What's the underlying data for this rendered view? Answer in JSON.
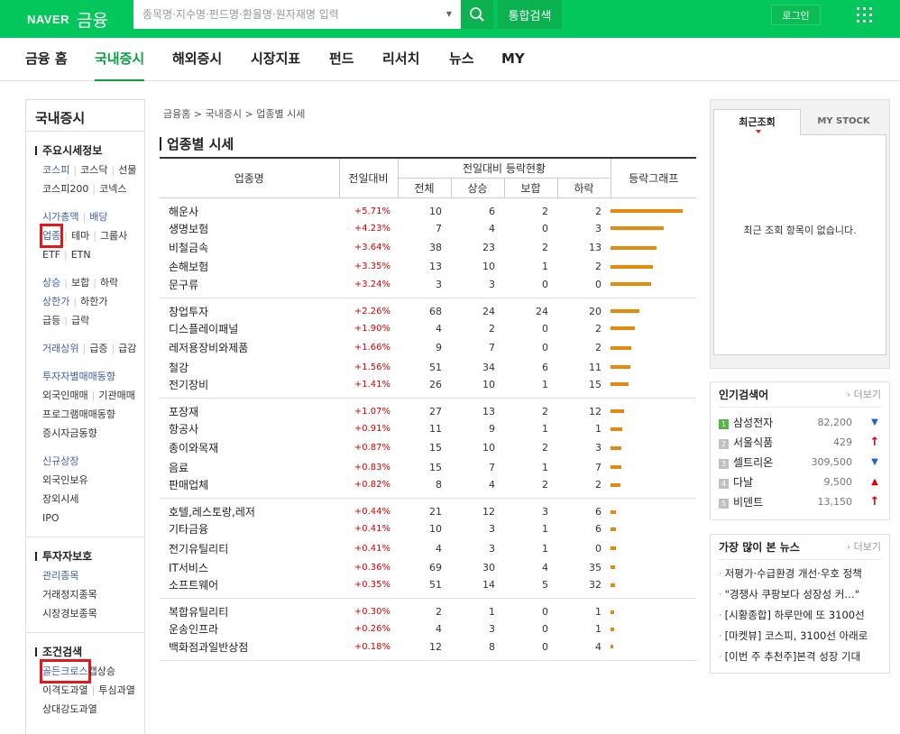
{
  "header": {
    "logo_brand": "NAVER",
    "logo_section": "금융",
    "search_placeholder": "종목명·지수명·펀드명·환율명·원자재명 입력",
    "unified_search_label": "통합검색",
    "login_label": "로그인"
  },
  "gnb": [
    {
      "label": "금융 홈",
      "active": false
    },
    {
      "label": "국내증시",
      "active": true
    },
    {
      "label": "해외증시",
      "active": false
    },
    {
      "label": "시장지표",
      "active": false
    },
    {
      "label": "펀드",
      "active": false
    },
    {
      "label": "리서치",
      "active": false
    },
    {
      "label": "뉴스",
      "active": false
    },
    {
      "label": "MY",
      "active": false
    }
  ],
  "lnb": {
    "title": "국내증시",
    "sections": [
      {
        "title": "주요시세정보",
        "rows": [
          [
            {
              "t": "코스피",
              "c": "blue"
            },
            {
              "t": "코스닥",
              "c": ""
            },
            {
              "t": "선물",
              "c": ""
            }
          ],
          [
            {
              "t": "코스피200",
              "c": ""
            },
            {
              "t": "코넥스",
              "c": ""
            }
          ],
          [],
          [
            {
              "t": "시가총액",
              "c": "blue"
            },
            {
              "t": "배당",
              "c": "blue"
            }
          ],
          [
            {
              "t": "업종",
              "c": "blue",
              "hl": true
            },
            {
              "t": "테마",
              "c": ""
            },
            {
              "t": "그룹사",
              "c": ""
            }
          ],
          [
            {
              "t": "ETF",
              "c": ""
            },
            {
              "t": "ETN",
              "c": ""
            }
          ],
          [],
          [
            {
              "t": "상승",
              "c": "blue"
            },
            {
              "t": "보합",
              "c": ""
            },
            {
              "t": "하락",
              "c": ""
            }
          ],
          [
            {
              "t": "상한가",
              "c": "blue"
            },
            {
              "t": "하한가",
              "c": ""
            }
          ],
          [
            {
              "t": "급등",
              "c": ""
            },
            {
              "t": "급락",
              "c": ""
            }
          ],
          [],
          [
            {
              "t": "거래상위",
              "c": "blue"
            },
            {
              "t": "급증",
              "c": ""
            },
            {
              "t": "급감",
              "c": ""
            }
          ],
          [],
          [
            {
              "t": "투자자별매매동향",
              "c": "blue"
            }
          ],
          [
            {
              "t": "외국인매매",
              "c": ""
            },
            {
              "t": "기관매매",
              "c": ""
            }
          ],
          [
            {
              "t": "프로그램매매동향",
              "c": ""
            }
          ],
          [
            {
              "t": "증시자금동향",
              "c": ""
            }
          ],
          [],
          [
            {
              "t": "신규상장",
              "c": "blue"
            }
          ],
          [
            {
              "t": "외국인보유",
              "c": ""
            }
          ],
          [
            {
              "t": "장외시세",
              "c": ""
            }
          ],
          [
            {
              "t": "IPO",
              "c": ""
            }
          ]
        ]
      },
      {
        "title": "투자자보호",
        "rows": [
          [
            {
              "t": "관리종목",
              "c": "blue"
            }
          ],
          [
            {
              "t": "거래정지종목",
              "c": ""
            }
          ],
          [
            {
              "t": "시장경보종목",
              "c": ""
            }
          ]
        ]
      },
      {
        "title": "조건검색",
        "rows": [
          [
            {
              "t": "골든크로스",
              "c": "blue",
              "hl": true
            },
            {
              "t": "갭상승",
              "c": "",
              "nosep": true
            }
          ],
          [
            {
              "t": "이격도과열",
              "c": ""
            },
            {
              "t": "투심과열",
              "c": ""
            }
          ],
          [
            {
              "t": "상대강도과열",
              "c": ""
            }
          ]
        ]
      }
    ]
  },
  "main": {
    "breadcrumb": "금융홈 > 국내증시 > 업종별 시세",
    "title": "업종별 시세",
    "headers": {
      "name": "업종명",
      "change": "전일대비",
      "group": "전일대비 등락현황",
      "total": "전체",
      "up": "상승",
      "flat": "보합",
      "down": "하락",
      "graph": "등락그래프"
    },
    "groups": [
      [
        {
          "name": "해운사",
          "change": "+5.71%",
          "total": 10,
          "up": 6,
          "flat": 2,
          "down": 2,
          "pct": 5.71
        },
        {
          "name": "생명보험",
          "change": "+4.23%",
          "total": 7,
          "up": 4,
          "flat": 0,
          "down": 3,
          "pct": 4.23
        },
        {
          "name": "비철금속",
          "change": "+3.64%",
          "total": 38,
          "up": 23,
          "flat": 2,
          "down": 13,
          "pct": 3.64
        },
        {
          "name": "손해보험",
          "change": "+3.35%",
          "total": 13,
          "up": 10,
          "flat": 1,
          "down": 2,
          "pct": 3.35
        },
        {
          "name": "문구류",
          "change": "+3.24%",
          "total": 3,
          "up": 3,
          "flat": 0,
          "down": 0,
          "pct": 3.24
        }
      ],
      [
        {
          "name": "창업투자",
          "change": "+2.26%",
          "total": 68,
          "up": 24,
          "flat": 24,
          "down": 20,
          "pct": 2.26
        },
        {
          "name": "디스플레이패널",
          "change": "+1.90%",
          "total": 4,
          "up": 2,
          "flat": 0,
          "down": 2,
          "pct": 1.9
        },
        {
          "name": "레저용장비와제품",
          "change": "+1.66%",
          "total": 9,
          "up": 7,
          "flat": 0,
          "down": 2,
          "pct": 1.66
        },
        {
          "name": "철강",
          "change": "+1.56%",
          "total": 51,
          "up": 34,
          "flat": 6,
          "down": 11,
          "pct": 1.56
        },
        {
          "name": "전기장비",
          "change": "+1.41%",
          "total": 26,
          "up": 10,
          "flat": 1,
          "down": 15,
          "pct": 1.41
        }
      ],
      [
        {
          "name": "포장재",
          "change": "+1.07%",
          "total": 27,
          "up": 13,
          "flat": 2,
          "down": 12,
          "pct": 1.07
        },
        {
          "name": "항공사",
          "change": "+0.91%",
          "total": 11,
          "up": 9,
          "flat": 1,
          "down": 1,
          "pct": 0.91
        },
        {
          "name": "종이와목재",
          "change": "+0.87%",
          "total": 15,
          "up": 10,
          "flat": 2,
          "down": 3,
          "pct": 0.87
        },
        {
          "name": "음료",
          "change": "+0.83%",
          "total": 15,
          "up": 7,
          "flat": 1,
          "down": 7,
          "pct": 0.83
        },
        {
          "name": "판매업체",
          "change": "+0.82%",
          "total": 8,
          "up": 4,
          "flat": 2,
          "down": 2,
          "pct": 0.82
        }
      ],
      [
        {
          "name": "호텔,레스토랑,레저",
          "change": "+0.44%",
          "total": 21,
          "up": 12,
          "flat": 3,
          "down": 6,
          "pct": 0.44
        },
        {
          "name": "기타금융",
          "change": "+0.41%",
          "total": 10,
          "up": 3,
          "flat": 1,
          "down": 6,
          "pct": 0.41
        },
        {
          "name": "전기유틸리티",
          "change": "+0.41%",
          "total": 4,
          "up": 3,
          "flat": 1,
          "down": 0,
          "pct": 0.41
        },
        {
          "name": "IT서비스",
          "change": "+0.36%",
          "total": 69,
          "up": 30,
          "flat": 4,
          "down": 35,
          "pct": 0.36
        },
        {
          "name": "소프트웨어",
          "change": "+0.35%",
          "total": 51,
          "up": 14,
          "flat": 5,
          "down": 32,
          "pct": 0.35
        }
      ],
      [
        {
          "name": "복합유틸리티",
          "change": "+0.30%",
          "total": 2,
          "up": 1,
          "flat": 0,
          "down": 1,
          "pct": 0.3
        },
        {
          "name": "운송인프라",
          "change": "+0.26%",
          "total": 4,
          "up": 3,
          "flat": 0,
          "down": 1,
          "pct": 0.26
        },
        {
          "name": "백화점과일반상점",
          "change": "+0.18%",
          "total": 12,
          "up": 8,
          "flat": 0,
          "down": 4,
          "pct": 0.18
        }
      ]
    ]
  },
  "right": {
    "tab_recent": "최근조회",
    "tab_mystock": "MY STOCK",
    "recent_empty": "최근 조회 항목이 없습니다.",
    "popular_title": "인기검색어",
    "more_label": "더보기",
    "popular": [
      {
        "rank": "1",
        "name": "삼성전자",
        "price": "82,200",
        "dir": "down"
      },
      {
        "rank": "2",
        "name": "서울식품",
        "price": "429",
        "dir": "upper"
      },
      {
        "rank": "3",
        "name": "셀트리온",
        "price": "309,500",
        "dir": "down"
      },
      {
        "rank": "4",
        "name": "다날",
        "price": "9,500",
        "dir": "up"
      },
      {
        "rank": "5",
        "name": "비덴트",
        "price": "13,150",
        "dir": "upper"
      }
    ],
    "news_title": "가장 많이 본 뉴스",
    "news": [
      "저평가·수급환경 개선·우호 정책",
      "\"경쟁사 쿠팡보다 성장성 커…\"",
      "[시황종합] 하루만에 또 3100선",
      "[마켓뷰] 코스피, 3100선 아래로",
      "[이번 주 추천주]본격 성장 기대"
    ]
  },
  "colors": {
    "brand": "#03c75a",
    "up": "#d80000",
    "down": "#1e64d6",
    "bar": "#e68a0d",
    "link": "#3d5fa9"
  }
}
